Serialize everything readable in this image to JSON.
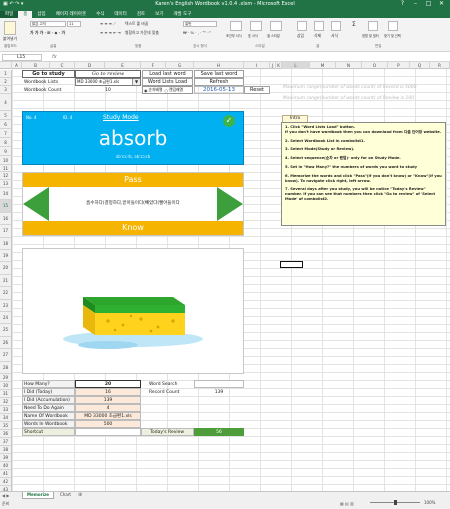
{
  "window": {
    "title": "Karen's English Wordbook v1.0.4 .xlsm - Microsoft Excel"
  },
  "ribbon": {
    "tabs": [
      "파일",
      "홈",
      "삽입",
      "페이지 레이아웃",
      "수식",
      "데이터",
      "검토",
      "보기",
      "개발 도구"
    ],
    "active_tab": "홈",
    "font_name": "맑은 고딕",
    "font_size": "11",
    "groups": [
      "클립보드",
      "글꼴",
      "맞춤",
      "표시 형식",
      "스타일",
      "셀",
      "편집"
    ],
    "wrap_text": "텍스트 줄 바꿈",
    "merge_center": "병합하고 가운데 맞춤",
    "number_format": "일반",
    "styles": [
      "조건부 서식",
      "표 서식",
      "셀 스타일"
    ],
    "cells": [
      "삽입",
      "삭제",
      "서식"
    ],
    "editing": [
      "정렬 및 필터",
      "찾기 및 선택"
    ],
    "paste": "붙여넣기"
  },
  "formula_bar": {
    "name_box": "L15",
    "fx": "fx"
  },
  "columns": [
    "A",
    "B",
    "C",
    "D",
    "E",
    "F",
    "G",
    "H",
    "I",
    "J",
    "K",
    "L",
    "M",
    "N",
    "O",
    "P",
    "Q",
    "R"
  ],
  "top": {
    "go_to_study": "Go to study",
    "go_to_review": "Go to review",
    "load_last_word": "Load last word",
    "save_last_word": "Save last word",
    "wordbook_lists_label": "Wordbook Lists",
    "wordbook_file": "MD 33000 초급편1.xls",
    "word_lists_load": "Word Lists Load",
    "refresh": "Refresh",
    "wordbook_count_label": "Wordbook Count",
    "wordbook_count_value": "10",
    "order_sequential": "순차배열",
    "order_random": "랜덤배열",
    "date": "2016-05-13",
    "reset": "Reset"
  },
  "study": {
    "no": "No. 4",
    "id": "ID. 4",
    "mode": "Study Mode",
    "word": "absorb",
    "pronunciation": "əbˈsɔːrb, əbˈzɔːrb",
    "pass": "Pass",
    "meaning": "흡수하다(결정하다,받아들이다(빼았다(빨아들이다",
    "know": "Know"
  },
  "stats": {
    "how_many_label": "How Many?",
    "how_many_value": "20",
    "i_did_today_label": "I Did (Today)",
    "i_did_today_value": "16",
    "i_did_accum_label": "I Did (Accumulation)",
    "i_did_accum_value": "139",
    "need_to_do_label": "Need To Do Again",
    "need_to_do_value": "4",
    "name_label": "Name Of Wordbook",
    "name_value": "MD 33000 초급편1.xls",
    "words_label": "Words In Wordbook",
    "words_value": "500",
    "shortcut_label": "Shortcut",
    "word_search_label": "Word Search",
    "record_count_label": "Record Count",
    "record_count_value": "139",
    "todays_review_label": "Today's Review",
    "todays_review_value": "56"
  },
  "right": {
    "max_record": "Maximum range(number of words count) of Record is 5000",
    "max_review": "Maximum range(number of words count) of Review is 100",
    "intro_title": "Intro",
    "intro_1": "1. Click \"Word Lists Load\" button.",
    "intro_1b": "If you don't have wordbook then you can download from 다음 단어장 website.",
    "intro_2": "2. Select Wordbook List in combolist1.",
    "intro_3": "3. Select Mode(Study or Review).",
    "intro_4": "4. Select sequence(순차 or 랜덤)- only for on Study Mode.",
    "intro_5": "5. Set in \"How Many?\" the numbers of words you want to study",
    "intro_6": "6. Memorize the words and click \"Pass\"(if you don't know) or \"Know\"(if you know).  To navigate click right, left arrow.",
    "intro_7": "7. Several days after you study, you will be notice \"Today's Review\" number. If you can see that numbers then click \"Go to review\" of 'Select Mode' of combolist2."
  },
  "status": {
    "sheet_tabs": [
      "Memorize",
      "Chart"
    ],
    "ready": "준비",
    "zoom": "100%"
  },
  "colors": {
    "excel_green": "#217346",
    "study_blue": "#00b0f0",
    "pass_orange": "#f4b400",
    "arrow_green": "#3c9f3c",
    "sponge_yellow": "#ffd21e",
    "sponge_green": "#2ea62e"
  }
}
